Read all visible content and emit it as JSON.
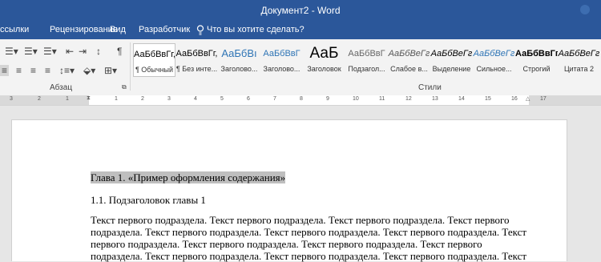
{
  "titlebar": {
    "title": "Документ2 - Word"
  },
  "tabs": [
    "ссылки",
    "Рецензирование",
    "Вид",
    "Разработчик"
  ],
  "tellme": {
    "label": "Что вы хотите сделать?",
    "icon": "lightbulb-icon"
  },
  "ribbon": {
    "paragraph_label": "Абзац",
    "styles_label": "Стили",
    "styles": [
      {
        "preview": "АаБбВвГг,",
        "label": "¶ Обычный",
        "selected": true
      },
      {
        "preview": "АаБбВвГг,",
        "label": "¶ Без инте..."
      },
      {
        "preview": "АаБбВı",
        "label": "Заголово..."
      },
      {
        "preview": "АаБбВвГ",
        "label": "Заголово..."
      },
      {
        "preview": "АаБ",
        "label": "Заголовок"
      },
      {
        "preview": "АаБбВвГ",
        "label": "Подзагол..."
      },
      {
        "preview": "АаБбВеГг",
        "label": "Слабое в..."
      },
      {
        "preview": "АаБбВеГг",
        "label": "Выделение"
      },
      {
        "preview": "АаБбВеГг",
        "label": "Сильное..."
      },
      {
        "preview": "АаБбВвГг,",
        "label": "Строгий"
      },
      {
        "preview": "АаБбВеГг",
        "label": "Цитата 2"
      }
    ],
    "colors": {
      "tab_bar": "#2b579a",
      "accent": "#2b579a"
    }
  },
  "ruler": [
    "3",
    "2",
    "1",
    "1",
    "2",
    "3",
    "4",
    "5",
    "6",
    "7",
    "8",
    "9",
    "10",
    "11",
    "12",
    "13",
    "14",
    "15",
    "16",
    "17"
  ],
  "document": {
    "heading": "Глава 1. «Пример оформления содержания»",
    "subheading": "1.1. Подзаголовок главы 1",
    "lines": [
      "Текст первого подраздела. Текст первого подраздела. Текст первого подраздела. Текст первого",
      "подраздела. Текст первого подраздела. Текст первого подраздела. Текст первого подраздела. Текст",
      "первого подраздела. Текст первого подраздела. Текст первого подраздела. Текст первого",
      "подраздела. Текст первого подраздела. Текст первого подраздела. Текст первого подраздела. Текст"
    ]
  }
}
